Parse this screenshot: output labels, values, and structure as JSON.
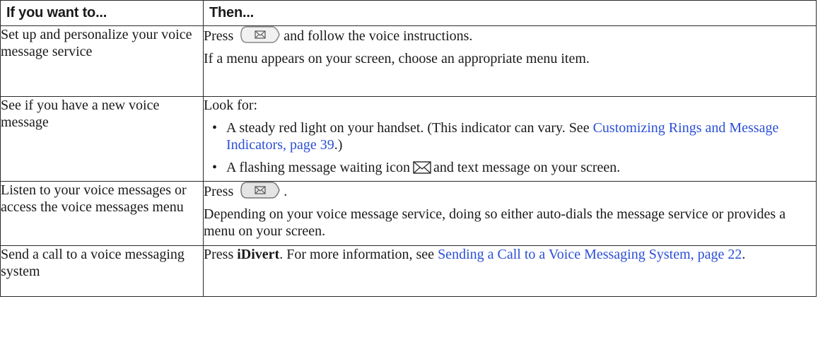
{
  "table": {
    "header": {
      "col1": "If you want to...",
      "col2": "Then..."
    },
    "rows": [
      {
        "action": "Set up and personalize your voice message service",
        "press": "Press",
        "after_button": "and follow the voice instructions.",
        "note": "If a menu appears on your screen, choose an appropriate menu item."
      },
      {
        "action": "See if you have a new voice message",
        "intro": "Look for:",
        "bullet1_text": "A steady red light on your handset. (This indicator can vary. See",
        "bullet1_link": "Customizing Rings and Message Indicators, page 39",
        "bullet1_tail": ".)",
        "bullet2_before": "A flashing message waiting icon",
        "bullet2_after": "and text message on your screen."
      },
      {
        "action": "Listen to your voice messages or access the voice messages menu",
        "press": "Press",
        "after_button": ".",
        "note": "Depending on your voice message service, doing so either auto-dials the message service or provides a menu on your screen."
      },
      {
        "action": "Send a call to a voice messaging system",
        "press": "Press",
        "softkey": "iDivert",
        "mid": ". For more information, see",
        "link": "Sending a Call to a Voice Messaging System, page 22",
        "tail": "."
      }
    ]
  },
  "icons": {
    "messages_button": "messages-button-icon",
    "message_waiting": "message-waiting-icon"
  },
  "colors": {
    "link": "#2b4fd6",
    "border": "#2a2a2a"
  }
}
